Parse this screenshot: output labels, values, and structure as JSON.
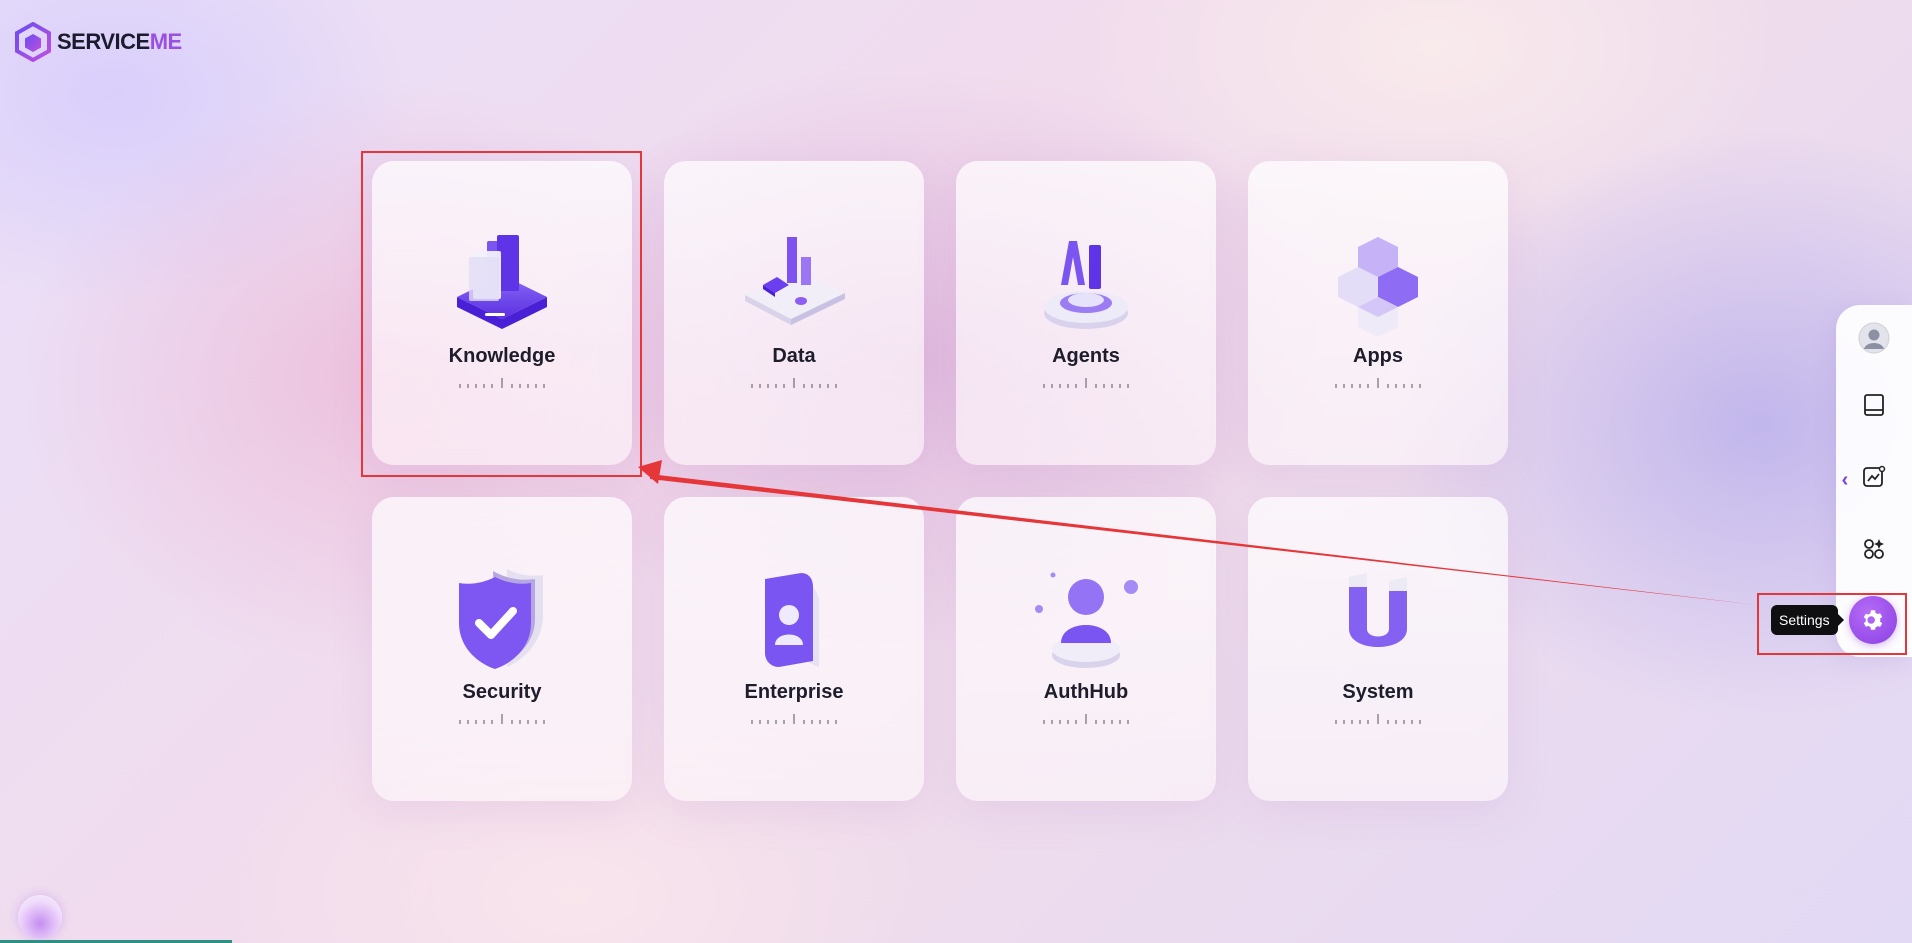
{
  "brand": {
    "name_main": "SERVICE",
    "name_accent": "ME"
  },
  "cards": [
    {
      "title": "Knowledge",
      "icon": "books-stack-icon"
    },
    {
      "title": "Data",
      "icon": "data-bars-icon"
    },
    {
      "title": "Agents",
      "icon": "ai-agent-icon"
    },
    {
      "title": "Apps",
      "icon": "cubes-icon"
    },
    {
      "title": "Security",
      "icon": "shield-check-icon"
    },
    {
      "title": "Enterprise",
      "icon": "enterprise-badge-icon"
    },
    {
      "title": "AuthHub",
      "icon": "user-auth-icon"
    },
    {
      "title": "System",
      "icon": "magnet-icon"
    }
  ],
  "sidebar": {
    "items": [
      {
        "icon": "user-avatar-icon"
      },
      {
        "icon": "book-icon"
      },
      {
        "icon": "chart-icon"
      },
      {
        "icon": "apps-grid-icon"
      }
    ],
    "collapse_label": "‹",
    "settings": {
      "icon": "gear-icon",
      "tooltip": "Settings"
    }
  },
  "colors": {
    "accent": "#8a3fe3",
    "annotation": "#e5363a"
  }
}
